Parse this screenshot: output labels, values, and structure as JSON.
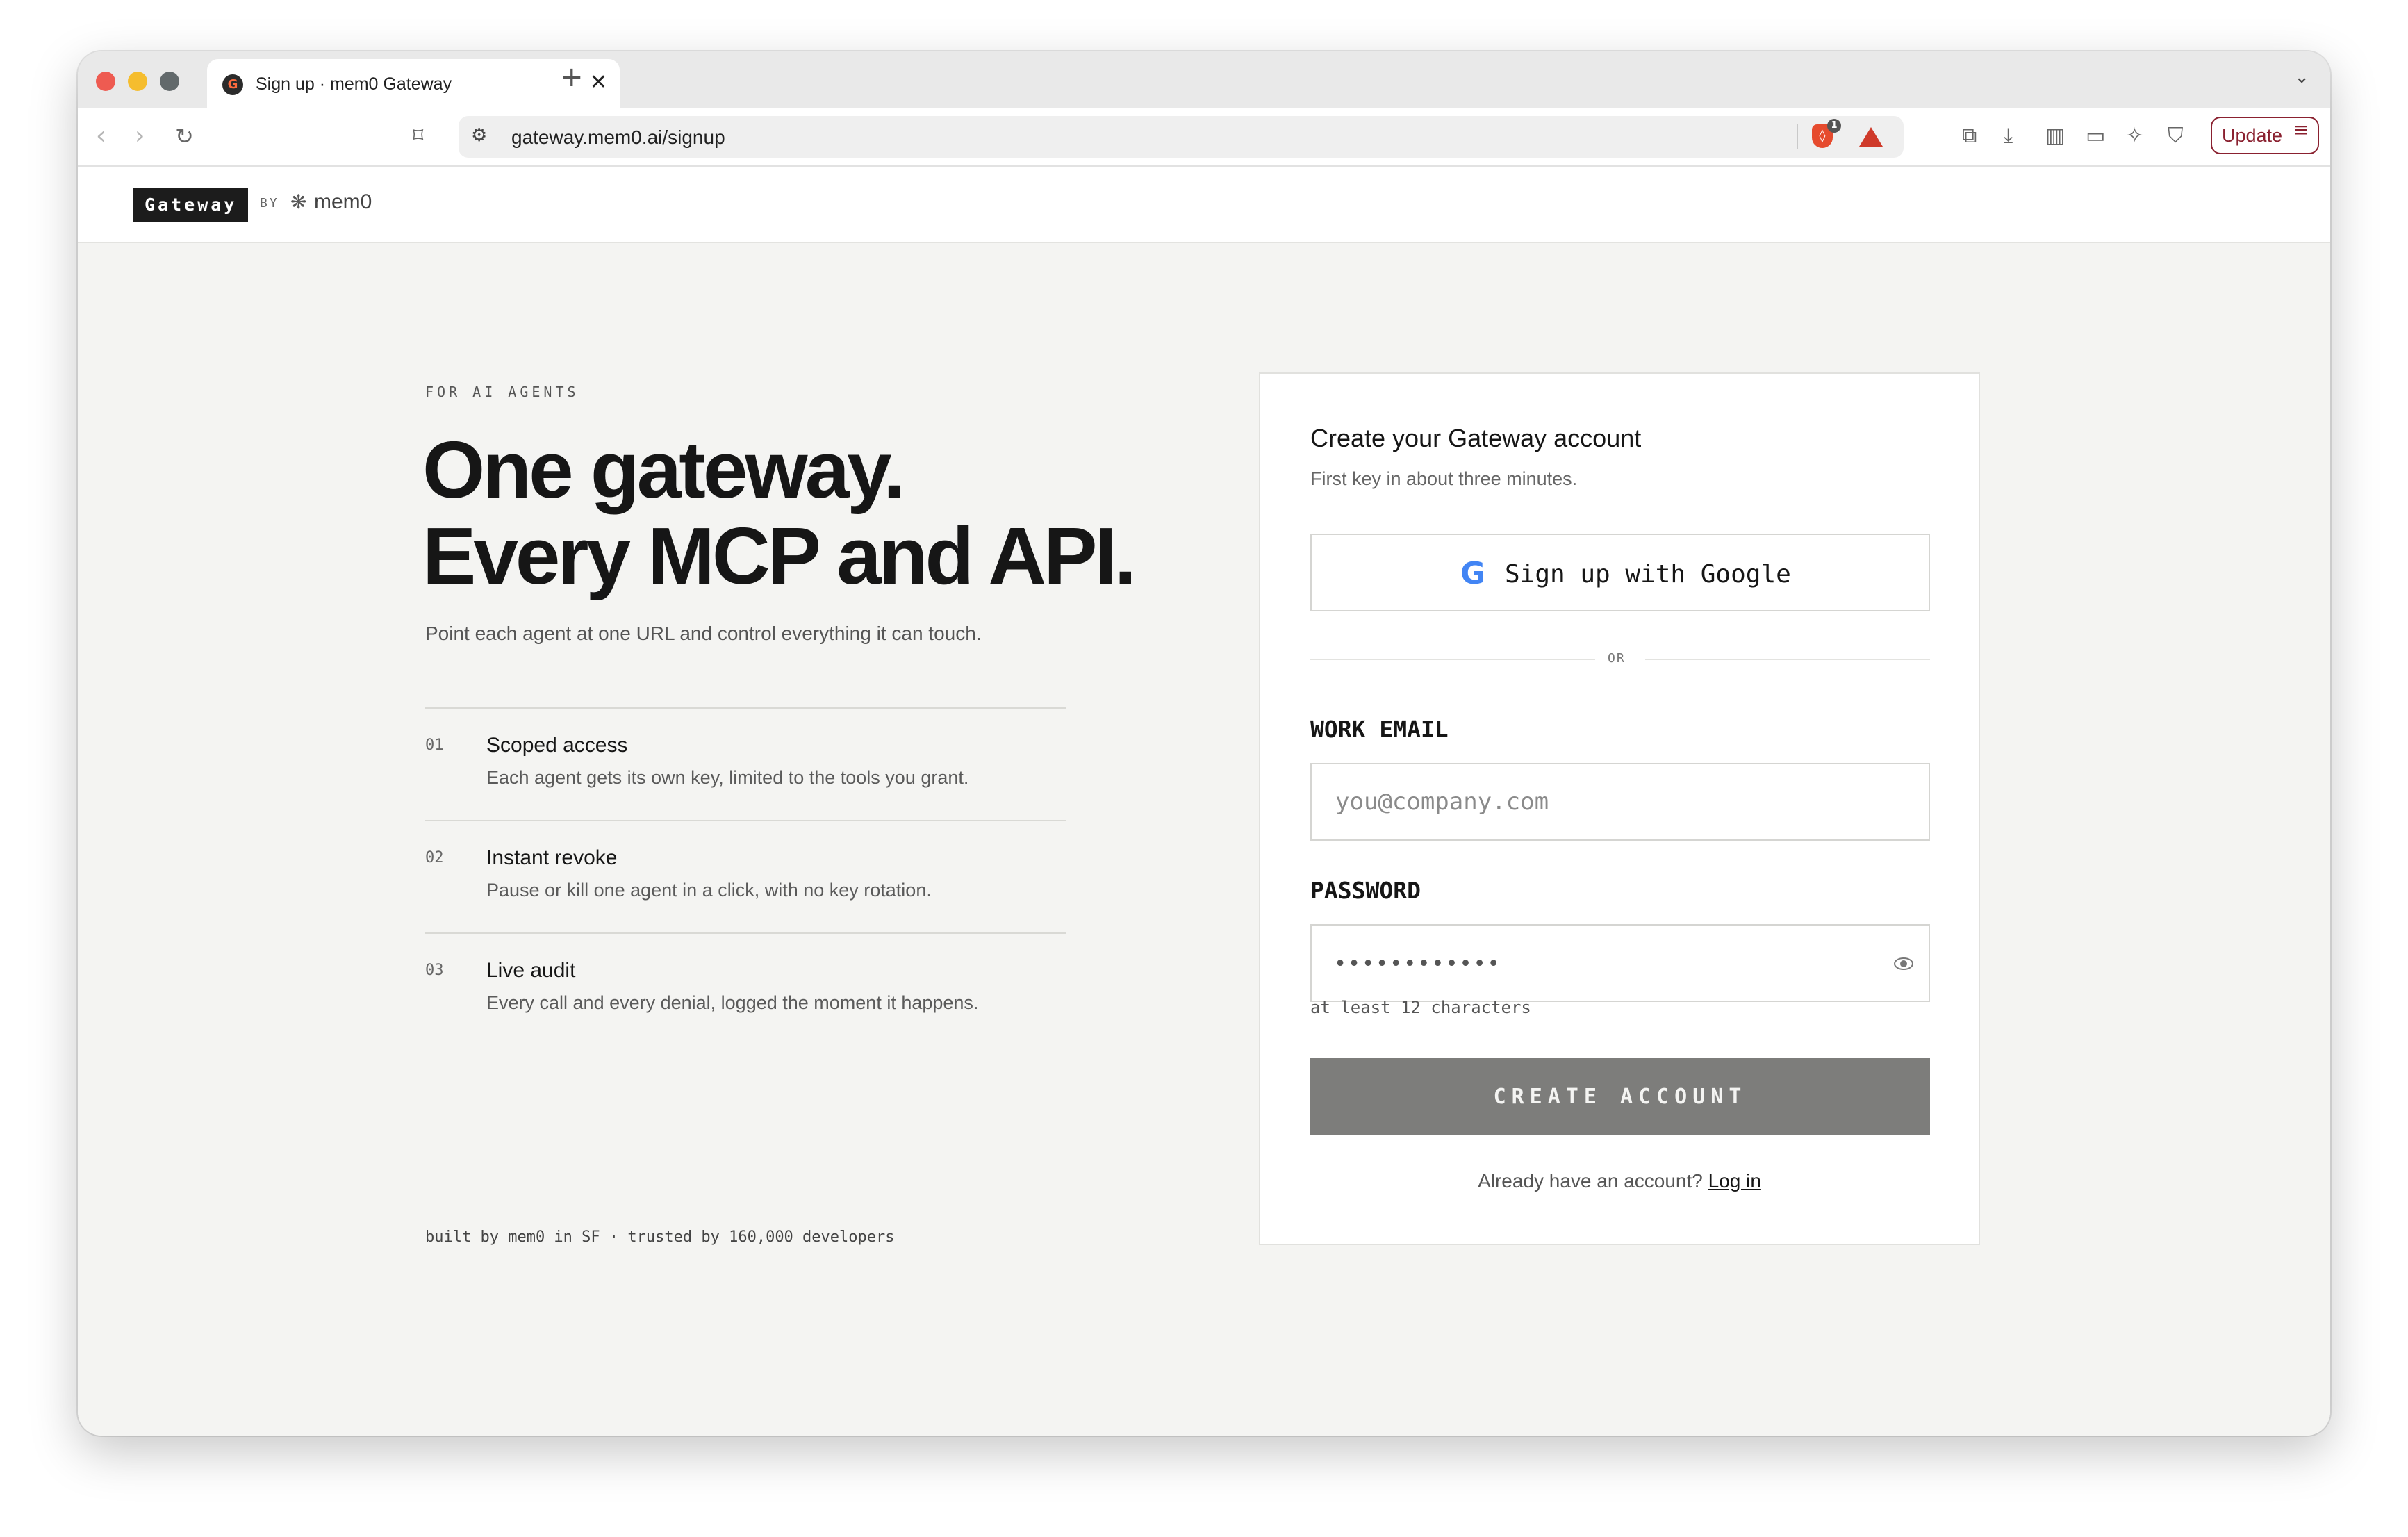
{
  "browser": {
    "tab_title": "Sign up · mem0 Gateway",
    "tab_close": "✕",
    "new_tab": "+",
    "url": "gateway.mem0.ai/signup",
    "shield_count": "1",
    "update_label": "Update"
  },
  "header": {
    "logo": "Gateway",
    "by": "BY",
    "brand": "mem0"
  },
  "hero": {
    "eyebrow": "FOR AI AGENTS",
    "headline_line1": "One gateway.",
    "headline_line2": "Every MCP and API.",
    "subline": "Point each agent at one URL and control everything it can touch."
  },
  "features": [
    {
      "num": "01",
      "title": "Scoped access",
      "desc": "Each agent gets its own key, limited to the tools you grant."
    },
    {
      "num": "02",
      "title": "Instant revoke",
      "desc": "Pause or kill one agent in a click, with no key rotation."
    },
    {
      "num": "03",
      "title": "Live audit",
      "desc": "Every call and every denial, logged the moment it happens."
    }
  ],
  "footnote": "built by mem0 in SF · trusted by 160,000 developers",
  "signup": {
    "title": "Create your Gateway account",
    "subtitle": "First key in about three minutes.",
    "google_button": "Sign up with Google",
    "or": "OR",
    "email_label": "WORK EMAIL",
    "email_placeholder": "you@company.com",
    "password_label": "PASSWORD",
    "password_value": "••••••••••••",
    "password_hint": "at least 12 characters",
    "submit": "CREATE ACCOUNT",
    "login_prompt": "Already have an account?",
    "login_link": "Log in"
  },
  "colors": {
    "page_bg": "#f4f4f2",
    "text": "#161616",
    "submit_bg": "#7d7d7b",
    "update_accent": "#8a2130"
  }
}
